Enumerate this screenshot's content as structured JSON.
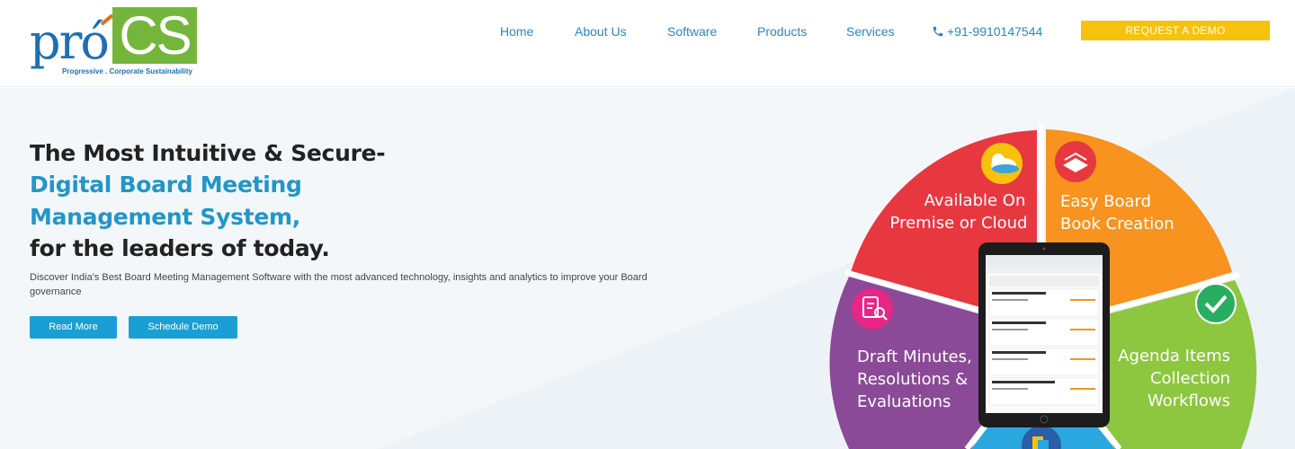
{
  "logo": {
    "pro": "pró",
    "cs": "CS",
    "tagline": "Progressive . Corporate Sustainability"
  },
  "nav": {
    "items": [
      {
        "label": "Home"
      },
      {
        "label": "About Us"
      },
      {
        "label": "Software"
      },
      {
        "label": "Products"
      },
      {
        "label": "Services"
      }
    ],
    "phone": "+91-9910147544",
    "cta": "REQUEST A DEMO"
  },
  "hero": {
    "line1": "The Most Intuitive & Secure-",
    "line2": "Digital Board Meeting",
    "line3": "Management System,",
    "line4": "for the leaders of today.",
    "subtitle": "Discover India's Best Board Meeting Management Software with the most advanced technology, insights and analytics to improve your Board governance",
    "read_more": "Read More",
    "schedule_demo": "Schedule Demo"
  },
  "wheel": {
    "seg_cloud": [
      "Available On",
      "Premise or Cloud"
    ],
    "seg_book": [
      "Easy Board",
      "Book Creation"
    ],
    "seg_minutes": [
      "Draft Minutes,",
      "Resolutions &",
      "Evaluations"
    ],
    "seg_agenda": [
      "Agenda Items",
      "Collection",
      "Workflows"
    ]
  },
  "colors": {
    "brand_blue": "#2196c9",
    "brand_green": "#74b63c",
    "cta_yellow": "#f7c20c",
    "seg_red": "#e8383f",
    "seg_orange": "#f7931e",
    "seg_purple": "#8a4a97",
    "seg_green": "#8dc63f",
    "seg_blue": "#29a8df"
  }
}
